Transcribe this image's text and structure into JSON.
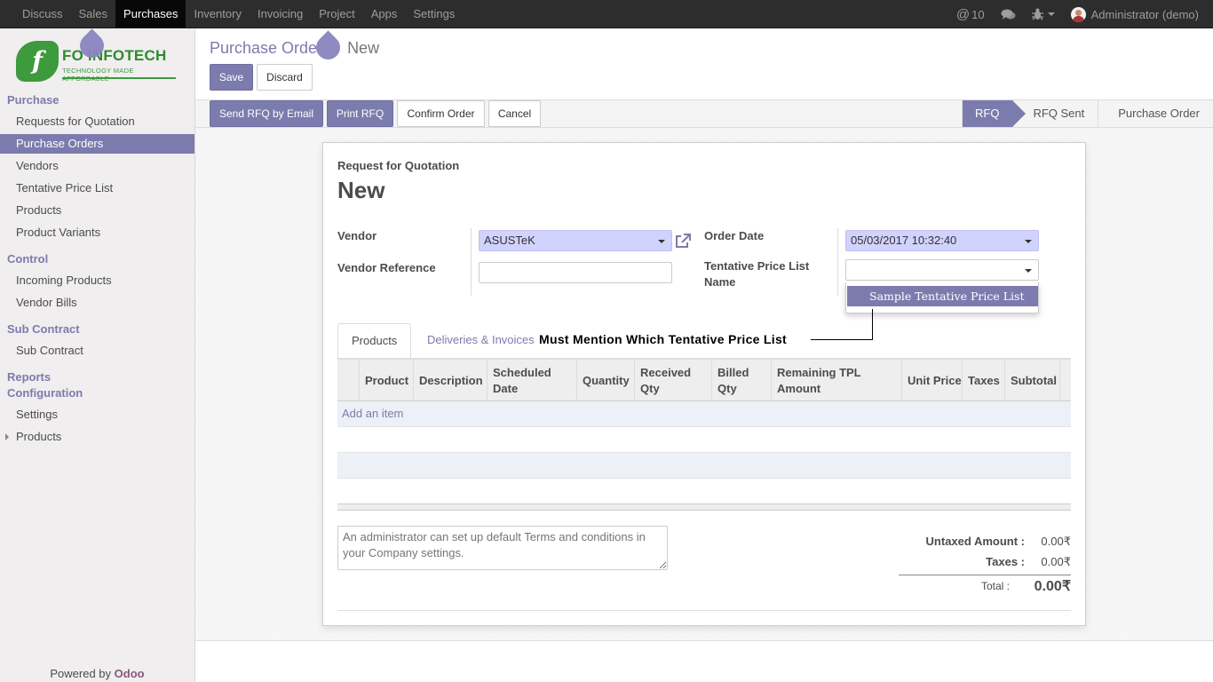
{
  "topbar": {
    "menu": [
      "Discuss",
      "Sales",
      "Purchases",
      "Inventory",
      "Invoicing",
      "Project",
      "Apps",
      "Settings"
    ],
    "active_menu": "Purchases",
    "mentions": "@",
    "mentions_count": "10",
    "user": "Administrator (demo)"
  },
  "logo": {
    "mark": "f",
    "name": "FO  INFOTECH",
    "tagline": "TECHNOLOGY MADE AFFORDABLE"
  },
  "sidebar": {
    "sections": [
      {
        "title": "Purchase",
        "items": [
          "Requests for Quotation",
          "Purchase Orders",
          "Vendors",
          "Tentative Price List",
          "Products",
          "Product Variants"
        ]
      },
      {
        "title": "Control",
        "items": [
          "Incoming Products",
          "Vendor Bills"
        ]
      },
      {
        "title": "Sub Contract",
        "items": [
          "Sub Contract"
        ]
      },
      {
        "title": "Reports",
        "items": []
      },
      {
        "title": "Configuration",
        "items": [
          "Settings",
          "Products"
        ]
      }
    ],
    "active_item": "Purchase Orders",
    "powered_by": "Powered by",
    "powered_brand": "Odoo"
  },
  "breadcrumb": {
    "parent": "Purchase Orde",
    "current": "New"
  },
  "buttons": {
    "save": "Save",
    "discard": "Discard",
    "send_rfq": "Send RFQ by Email",
    "print_rfq": "Print RFQ",
    "confirm": "Confirm Order",
    "cancel": "Cancel"
  },
  "status_steps": [
    "RFQ",
    "RFQ Sent",
    "Purchase Order"
  ],
  "active_step": "RFQ",
  "form": {
    "doc_type": "Request for Quotation",
    "doc_name": "New",
    "vendor_label": "Vendor",
    "vendor_value": "ASUSTeK",
    "vendor_ref_label": "Vendor Reference",
    "vendor_ref_value": "",
    "order_date_label": "Order Date",
    "order_date_value": "05/03/2017 10:32:40",
    "tpl_label_1": "Tentative Price List",
    "tpl_label_2": "Name",
    "tpl_value": "",
    "tpl_option": "Sample Tentative Price List"
  },
  "tabs": [
    "Products",
    "Deliveries & Invoices"
  ],
  "annotation": "Must Mention Which Tentative Price List",
  "grid": {
    "columns": [
      "Product",
      "Description",
      "Scheduled Date",
      "Quantity",
      "Received Qty",
      "Billed Qty",
      "Remaining TPL Amount",
      "Unit Price",
      "Taxes",
      "Subtotal"
    ],
    "add_item": "Add an item"
  },
  "notes_placeholder": "An administrator can set up default Terms and conditions in your Company settings.",
  "totals": {
    "untaxed_label": "Untaxed Amount :",
    "untaxed_value": "0.00₹",
    "taxes_label": "Taxes :",
    "taxes_value": "0.00₹",
    "total_label": "Total :",
    "total_value": "0.00₹"
  },
  "colors": {
    "accent": "#7c7bad",
    "navbar": "#2d2d2d",
    "required": "#d2d2ff"
  }
}
